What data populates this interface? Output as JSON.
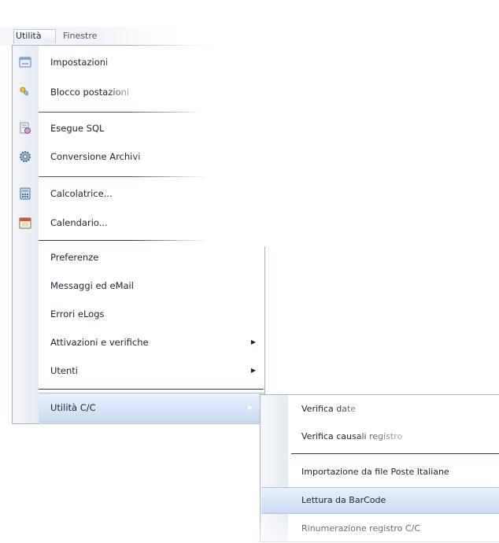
{
  "menubar": {
    "items": [
      {
        "label": "Utilità"
      },
      {
        "label": "Finestre"
      }
    ]
  },
  "menu": {
    "items": [
      {
        "label": "Impostazioni",
        "icon": "settings-window-icon"
      },
      {
        "label": "Blocco postazioni",
        "icon": "keys-icon"
      },
      {
        "label": "Esegue SQL",
        "icon": "sql-script-icon"
      },
      {
        "label": "Conversione Archivi",
        "icon": "gear-icon"
      },
      {
        "label": "Calcolatrice...",
        "icon": "calculator-icon"
      },
      {
        "label": "Calendario...",
        "icon": "calendar-icon"
      },
      {
        "label": "Preferenze"
      },
      {
        "label": "Messaggi ed eMail"
      },
      {
        "label": "Errori eLogs"
      },
      {
        "label": "Attivazioni e verifiche",
        "submenu": true
      },
      {
        "label": "Utenti",
        "submenu": true
      },
      {
        "label": "Utilità C/C",
        "submenu": true,
        "highlighted": true
      }
    ]
  },
  "submenu": {
    "items": [
      {
        "label": "Verifica date"
      },
      {
        "label": "Verifica causali registro"
      },
      {
        "label": "Importazione da file Poste Italiane"
      },
      {
        "label": "Lettura da BarCode",
        "highlighted": true
      },
      {
        "label": "Rinumerazione registro C/C"
      }
    ]
  },
  "colors": {
    "highlight_top": "#e9f1fc",
    "highlight_bottom": "#c8daf3",
    "highlight_border": "#a9c1e4",
    "separator": "#2c3a4c",
    "text": "#1b2433"
  }
}
